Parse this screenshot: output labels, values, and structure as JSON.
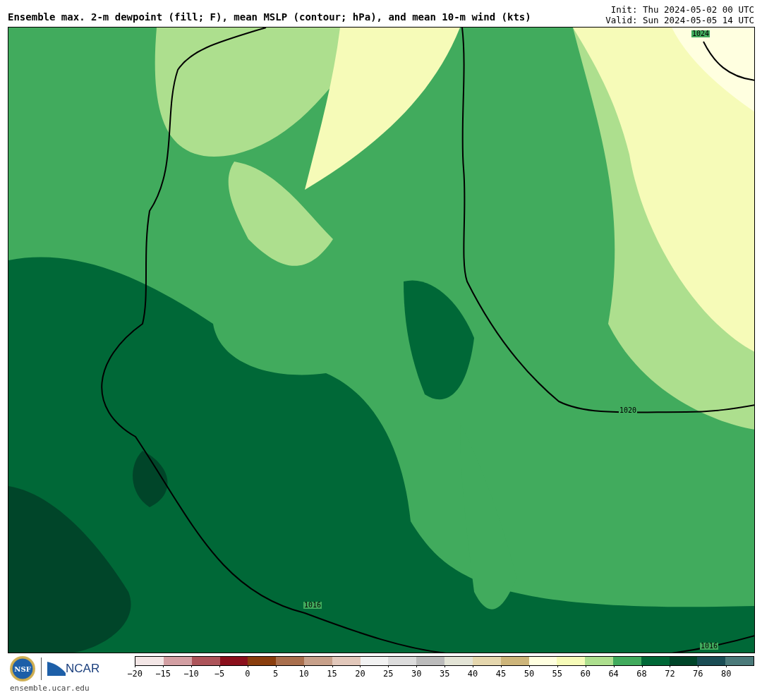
{
  "header": {
    "title": "Ensemble max. 2-m dewpoint (fill; F), mean MSLP (contour; hPa), and mean 10-m wind (kts)",
    "init": "Init: Thu 2024-05-02 00 UTC",
    "valid": "Valid: Sun 2024-05-05 14 UTC"
  },
  "map": {
    "contour_labels": [
      "1024",
      "1020",
      "1016",
      "1016"
    ]
  },
  "footer": {
    "logos": [
      {
        "kind": "nsf",
        "text": "NSF"
      },
      {
        "kind": "ncar",
        "text": "NCAR"
      }
    ],
    "site": "ensemble.ucar.edu"
  },
  "colorbar": {
    "bins": [
      {
        "color": "#f3e6e6"
      },
      {
        "color": "#d39fa3"
      },
      {
        "color": "#ad545a"
      },
      {
        "color": "#8b101c"
      },
      {
        "color": "#8a3e0e"
      },
      {
        "color": "#a96f4d"
      },
      {
        "color": "#c7a08a"
      },
      {
        "color": "#e2c8bb"
      },
      {
        "color": "#f2f2f2"
      },
      {
        "color": "#dcdcdc"
      },
      {
        "color": "#bbbbbb"
      },
      {
        "color": "#e3e4d6"
      },
      {
        "color": "#e5d7ae"
      },
      {
        "color": "#cdb57a"
      },
      {
        "color": "#ffffe0"
      },
      {
        "color": "#f6fbb8"
      },
      {
        "color": "#addf8e"
      },
      {
        "color": "#41ab5d"
      },
      {
        "color": "#006837"
      },
      {
        "color": "#004529"
      },
      {
        "color": "#1a4d55"
      },
      {
        "color": "#4b7a7a"
      }
    ],
    "ticks": [
      "−20",
      "−15",
      "−10",
      "−5",
      "0",
      "5",
      "10",
      "15",
      "20",
      "25",
      "30",
      "35",
      "40",
      "45",
      "50",
      "55",
      "60",
      "64",
      "68",
      "72",
      "76",
      "80"
    ]
  }
}
